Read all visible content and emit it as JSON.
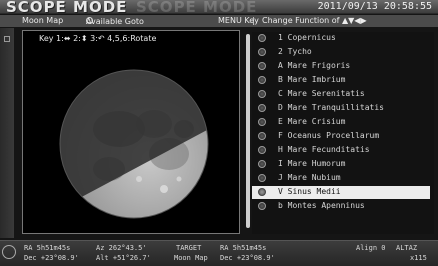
{
  "header": {
    "title": "SCOPE MODE",
    "datetime": "2011/09/13 20:58:55"
  },
  "menubar": {
    "mode": "Moon Map",
    "goto": "Available Goto",
    "menu_key": "MENU Key",
    "separator": "|",
    "change_function": "Change Function of ▲▼◀▶"
  },
  "map": {
    "key_hint": "Key 1:⬌ 2:⬍ 3:↶ 4,5,6:Rotate"
  },
  "objects": [
    {
      "label": "1 Copernicus"
    },
    {
      "label": "2 Tycho"
    },
    {
      "label": "A Mare Frigoris"
    },
    {
      "label": "B Mare Imbrium"
    },
    {
      "label": "C Mare Serenitatis"
    },
    {
      "label": "D Mare Tranquillitatis"
    },
    {
      "label": "E Mare Crisium"
    },
    {
      "label": "F Oceanus Procellarum"
    },
    {
      "label": "H Mare Fecunditatis"
    },
    {
      "label": "I Mare Humorum"
    },
    {
      "label": "J Mare Nubium"
    },
    {
      "label": "V Sinus Medii"
    },
    {
      "label": "b Montes Apenninus"
    }
  ],
  "selected_object": "V Sinus Medii",
  "status": {
    "ra": "RA  5h51m45s",
    "dec": "Dec +23°08.9'",
    "az": "Az 262°43.5'",
    "alt": "Alt +51°26.7'",
    "target": "TARGET",
    "target_name": "Moon Map",
    "target_ra": "RA   5h51m45s",
    "target_dec": "Dec +23°08.9'",
    "align": "Align 0",
    "altaz": "ALTAZ",
    "speed": "x115"
  },
  "colors": {
    "selected_row_bg": "#ececec",
    "selected_row_text": "#111111"
  },
  "icons": {
    "status": "telescope-icon",
    "bullet": "circle-bullet-icon"
  }
}
